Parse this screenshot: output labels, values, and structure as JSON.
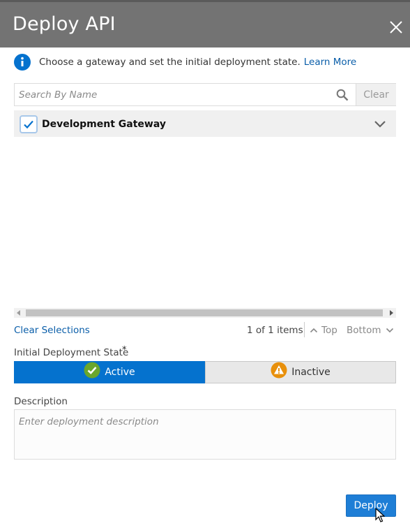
{
  "dialog": {
    "title": "Deploy API",
    "close_icon": "close-icon"
  },
  "info": {
    "icon": "info-icon",
    "text": "Choose a gateway and set the initial deployment state.",
    "learn_more": "Learn More"
  },
  "search": {
    "placeholder": "Search By Name",
    "value": "",
    "clear_label": "Clear"
  },
  "gateways": [
    {
      "name": "Development Gateway",
      "checked": true
    }
  ],
  "pagination": {
    "clear_selections": "Clear Selections",
    "count": "1 of 1 items",
    "top": "Top",
    "bottom": "Bottom"
  },
  "state": {
    "label": "Initial Deployment State",
    "required_marker": "*",
    "active": "Active",
    "inactive": "Inactive",
    "selected": "Active"
  },
  "description": {
    "label": "Description",
    "placeholder": "Enter deployment description",
    "value": ""
  },
  "footer": {
    "deploy_label": "Deploy"
  },
  "colors": {
    "header": "#737373",
    "primary": "#0572ce",
    "link": "#0a5ea9",
    "success": "#6aa62c",
    "warning": "#e8900c"
  }
}
